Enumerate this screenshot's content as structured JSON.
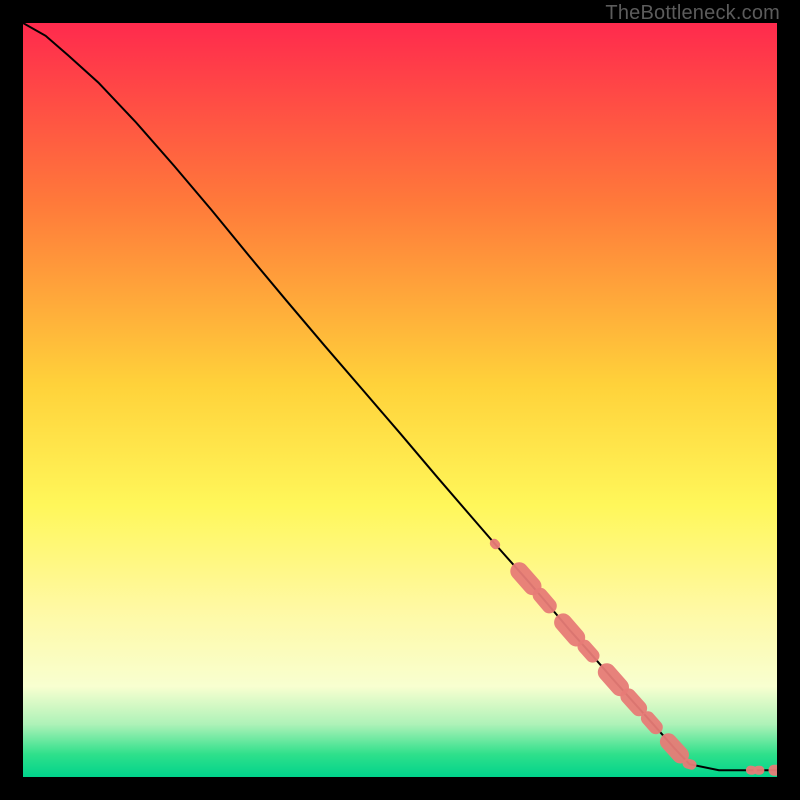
{
  "credit": "TheBottleneck.com",
  "colors": {
    "bg_page": "#000000",
    "gradient_top": "#ff2a4d",
    "gradient_mid1": "#ff7a3a",
    "gradient_mid2": "#ffd23a",
    "gradient_mid3": "#fff75a",
    "gradient_mid4": "#fff9a5",
    "gradient_mid5": "#f8ffd0",
    "gradient_green1": "#aef2b8",
    "gradient_green2": "#2fe08b",
    "gradient_green3": "#00d38b",
    "credit_text": "#5c5c5c",
    "curve": "#000000",
    "marker_fill": "#e77c77",
    "marker_stroke": "#c95f5a"
  },
  "chart_data": {
    "type": "line",
    "title": "",
    "xlabel": "",
    "ylabel": "",
    "xlim": [
      0,
      100
    ],
    "ylim": [
      0,
      100
    ],
    "note": "Axes are normalized 0–100; no ticks are shown in the source. x increases rightward, y increases upward. Values are read/estimated from the curve using interpolation against the plot box.",
    "series": [
      {
        "name": "curve",
        "style": "line",
        "x": [
          0.0,
          3.0,
          6.0,
          10.0,
          15.0,
          20.0,
          25.0,
          30.0,
          35.0,
          40.0,
          45.0,
          50.0,
          55.0,
          60.0,
          62.6,
          66.7,
          69.2,
          72.5,
          75.0,
          78.3,
          81.0,
          83.4,
          86.4,
          88.4,
          92.3,
          93.5,
          95.0,
          96.6,
          97.6,
          100.0
        ],
        "y": [
          100.0,
          98.3,
          95.7,
          92.1,
          86.8,
          81.1,
          75.2,
          69.1,
          63.1,
          57.2,
          51.4,
          45.6,
          39.7,
          33.9,
          30.9,
          26.3,
          23.4,
          19.5,
          16.7,
          12.9,
          9.9,
          7.2,
          3.8,
          1.7,
          0.9,
          0.9,
          0.9,
          0.9,
          0.9,
          0.9
        ],
        "color": "#000000"
      },
      {
        "name": "markers",
        "style": "scatter",
        "x": [
          62.6,
          66.7,
          69.2,
          72.5,
          75.0,
          78.3,
          81.0,
          83.4,
          86.4,
          88.4,
          96.6,
          97.6,
          100.0
        ],
        "y": [
          30.9,
          26.3,
          23.4,
          19.5,
          16.7,
          12.9,
          9.9,
          7.2,
          3.8,
          1.7,
          0.9,
          0.9,
          0.9
        ],
        "r": [
          5,
          14,
          11,
          14,
          10,
          14,
          12,
          10,
          13,
          6,
          5,
          5,
          7
        ],
        "marker_note": "r is approximate visual radius in plot-pixel units (elongated runs are modeled as single larger blobs).",
        "color": "#e77c77"
      }
    ],
    "gradient_stops": [
      {
        "offset": 0,
        "color": "#ff2a4d"
      },
      {
        "offset": 24,
        "color": "#ff7a3a"
      },
      {
        "offset": 48,
        "color": "#ffd23a"
      },
      {
        "offset": 64,
        "color": "#fff75a"
      },
      {
        "offset": 78,
        "color": "#fff9a5"
      },
      {
        "offset": 88,
        "color": "#f8ffd0"
      },
      {
        "offset": 93,
        "color": "#aef2b8"
      },
      {
        "offset": 97,
        "color": "#2fe08b"
      },
      {
        "offset": 100,
        "color": "#00d38b"
      }
    ]
  }
}
